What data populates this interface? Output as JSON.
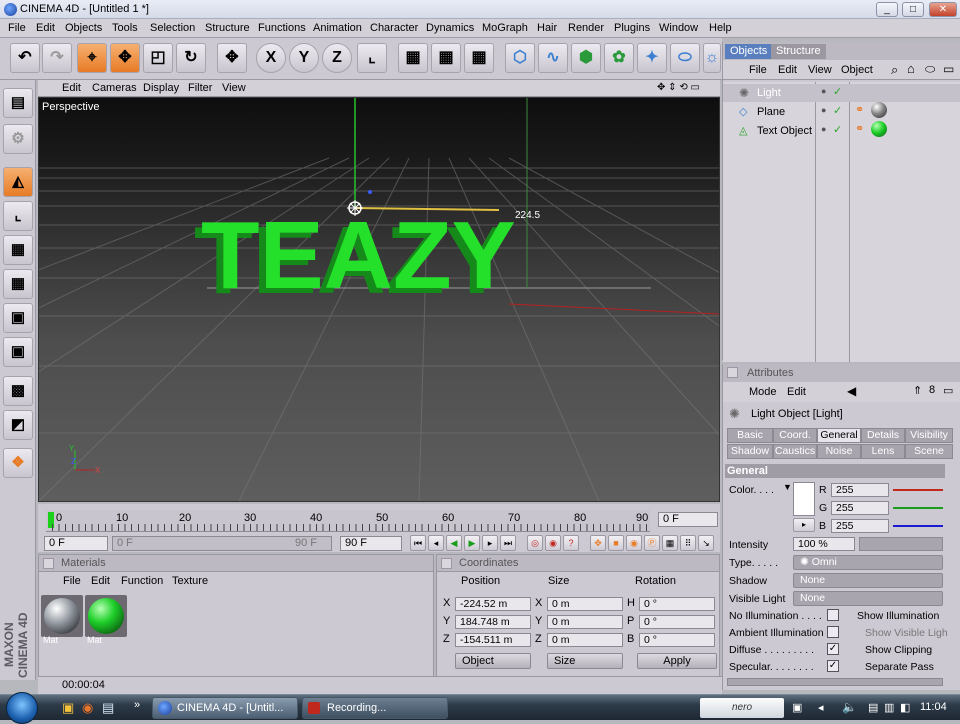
{
  "window": {
    "title": "CINEMA 4D - [Untitled 1 *]",
    "min": "_",
    "max": "□",
    "close": "✕"
  },
  "menu": [
    "File",
    "Edit",
    "Objects",
    "Tools",
    "Selection",
    "Structure",
    "Functions",
    "Animation",
    "Character",
    "Dynamics",
    "MoGraph",
    "Hair",
    "Render",
    "Plugins",
    "Window",
    "Help"
  ],
  "toolbar": {
    "axis_x": "X",
    "axis_y": "Y",
    "axis_z": "Z"
  },
  "viewport": {
    "menu": [
      "Edit",
      "Cameras",
      "Display",
      "Filter",
      "View"
    ],
    "label": "Perspective",
    "scene_text": "TEAZY",
    "measure": "224.5"
  },
  "timeline": {
    "ticks": [
      "0",
      "10",
      "20",
      "30",
      "40",
      "50",
      "60",
      "70",
      "80",
      "90"
    ],
    "current_frame": "0 F",
    "start": "0 F",
    "range_start": "0 F",
    "range_end": "90 F",
    "end": "90 F"
  },
  "materials": {
    "title": "Materials",
    "menu": [
      "File",
      "Edit",
      "Function",
      "Texture"
    ],
    "items": [
      "Mat",
      "Mat"
    ]
  },
  "coordinates": {
    "title": "Coordinates",
    "headers": [
      "Position",
      "Size",
      "Rotation"
    ],
    "rows": [
      {
        "axis": "X",
        "pos": "-224.52 m",
        "size_axis": "X",
        "size": "0 m",
        "rot_axis": "H",
        "rot": "0 °"
      },
      {
        "axis": "Y",
        "pos": "184.748 m",
        "size_axis": "Y",
        "size": "0 m",
        "rot_axis": "P",
        "rot": "0 °"
      },
      {
        "axis": "Z",
        "pos": "-154.511 m",
        "size_axis": "Z",
        "size": "0 m",
        "rot_axis": "B",
        "rot": "0 °"
      }
    ],
    "mode": "Object",
    "size_mode": "Size",
    "apply": "Apply"
  },
  "status": {
    "time": "00:00:04"
  },
  "side_brand": "MAXON CINEMA 4D",
  "objects": {
    "tabs": [
      "Objects",
      "Structure"
    ],
    "menu": [
      "File",
      "Edit",
      "View",
      "Object"
    ],
    "items": [
      "Light",
      "Plane",
      "Text Object"
    ]
  },
  "attributes": {
    "title": "Attributes",
    "menu": [
      "Mode",
      "Edit"
    ],
    "object": "Light Object [Light]",
    "tabs_row1": [
      "Basic",
      "Coord.",
      "General",
      "Details",
      "Visibility"
    ],
    "tabs_row2": [
      "Shadow",
      "Caustics",
      "Noise",
      "Lens",
      "Scene"
    ],
    "section": "General",
    "color_label": "Color. . . .",
    "r": "255",
    "g": "255",
    "b": "255",
    "intensity_label": "Intensity",
    "intensity": "100 %",
    "type_label": "Type. . . . .",
    "type": "Omni",
    "shadow_label": "Shadow",
    "shadow": "None",
    "visible_light_label": "Visible Light",
    "visible_light": "None",
    "checks": [
      {
        "label": "No Illumination . . . .",
        "checked": false,
        "right": "Show Illumination"
      },
      {
        "label": "Ambient Illumination",
        "checked": false,
        "right": "Show Visible Ligh"
      },
      {
        "label": "Diffuse . . . . . . . . .",
        "checked": true,
        "right": "Show Clipping"
      },
      {
        "label": "Specular. . . . . . . .",
        "checked": true,
        "right": "Separate Pass"
      }
    ]
  },
  "taskbar": {
    "tasks": [
      "CINEMA 4D - [Untitl...",
      "Recording..."
    ],
    "tray_brand": "nero",
    "clock": "11:04"
  },
  "colors": {
    "accent": "#e77b26",
    "text_green": "#25e02a",
    "panel": "#cdc9d3"
  }
}
